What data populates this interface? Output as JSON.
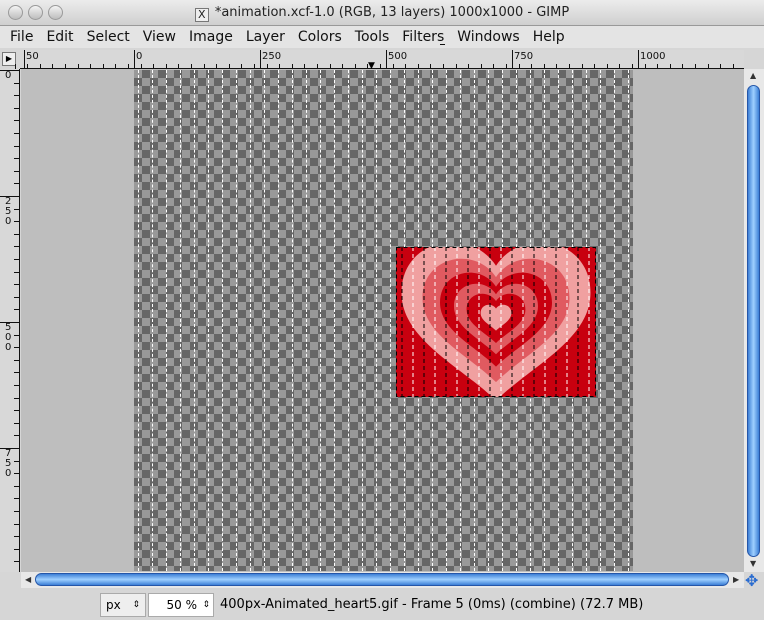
{
  "window": {
    "title": "*animation.xcf-1.0 (RGB, 13 layers) 1000x1000 - GIMP"
  },
  "menu": [
    {
      "label": "File",
      "u": "F",
      "rest": "ile"
    },
    {
      "label": "Edit",
      "u": "E",
      "rest": "dit"
    },
    {
      "label": "Select",
      "u": "S",
      "rest": "elect"
    },
    {
      "label": "View",
      "u": "V",
      "rest": "iew"
    },
    {
      "label": "Image",
      "u": "I",
      "rest": "mage"
    },
    {
      "label": "Layer",
      "u": "L",
      "rest": "ayer"
    },
    {
      "label": "Colors",
      "u": "C",
      "rest": "olors"
    },
    {
      "label": "Tools",
      "u": "T",
      "rest": "ools"
    },
    {
      "label": "Filters",
      "pre": "Filte",
      "u": "r",
      "rest": "s"
    },
    {
      "label": "Windows",
      "u": "W",
      "rest": "indows"
    },
    {
      "label": "Help",
      "u": "H",
      "rest": "elp"
    }
  ],
  "ruler": {
    "h_labels": [
      "50",
      "0",
      "250",
      "500",
      "750",
      "1000"
    ],
    "v_labels": [
      "0",
      "250",
      "500",
      "750"
    ]
  },
  "status": {
    "unit": "px",
    "zoom": "50 %",
    "info": "400px-Animated_heart5.gif - Frame 5 (0ms) (combine) (72.7 MB)"
  },
  "colors": {
    "accent": "#3c7fd6",
    "heart_dark": "#c8000f",
    "heart_mid": "#e05a60",
    "heart_light": "#f0a0a0"
  }
}
